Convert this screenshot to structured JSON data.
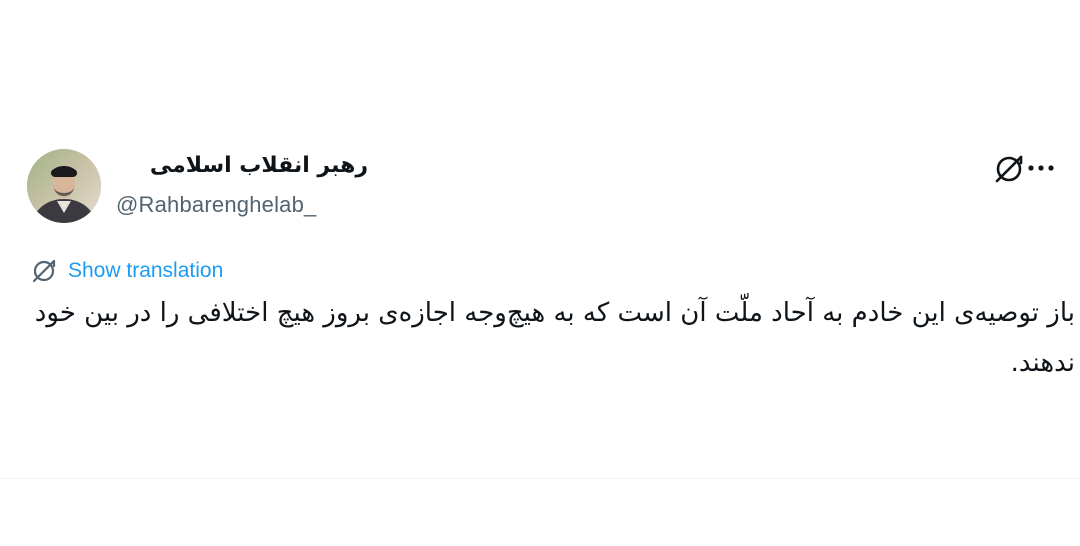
{
  "author": {
    "display_name": "رهبر انقلاب اسلامی",
    "handle": "@Rahbarenghelab_"
  },
  "header": {
    "grok_icon": "grok-slash-icon",
    "more_icon": "more-options-icon"
  },
  "translate": {
    "icon": "grok-slash-icon",
    "label": "Show translation"
  },
  "tweet": {
    "text": "باز توصیه‌ی این خادم به آحاد ملّت آن است که به هیچ‌وجه اجازه‌ی بروز هیچ اختلافی را در بین خود ندهند."
  },
  "colors": {
    "link": "#1d9bf0",
    "secondary_text": "#536471",
    "primary_text": "#0f1419",
    "divider": "#eff3f4"
  }
}
